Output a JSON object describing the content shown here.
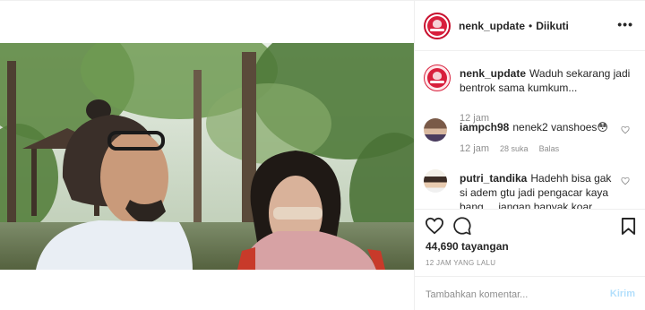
{
  "header": {
    "username": "nenk_update",
    "separator": "•",
    "follow_status": "Diikuti",
    "more_glyph": "•••"
  },
  "caption": {
    "username": "nenk_update",
    "text": "Waduh sekarang jadi bentrok sama kumkum...",
    "time": "12 jam"
  },
  "comments": [
    {
      "username": "iampch98",
      "text": "nenek2 vanshoes😳",
      "time": "12 jam",
      "likes": "28 suka",
      "reply": "Balas"
    },
    {
      "username": "putri_tandika",
      "text": "Hadehh bisa gak si adem gtu jadi pengacar kaya bang ... jangan banyak koar koar"
    }
  ],
  "actions": {
    "views": "44,690 tayangan",
    "posted": "12 JAM YANG LALU"
  },
  "comment_box": {
    "placeholder": "Tambahkan komentar...",
    "submit": "Kirim"
  },
  "colors": {
    "brand_red": "#d81f3c",
    "link_disabled": "#b2dffc",
    "muted": "#8e8e8e",
    "text": "#262626"
  },
  "icons": {
    "heart": "heart-outline-icon",
    "comment": "speech-bubble-icon",
    "save": "bookmark-icon",
    "comment_like": "small-heart-icon"
  }
}
